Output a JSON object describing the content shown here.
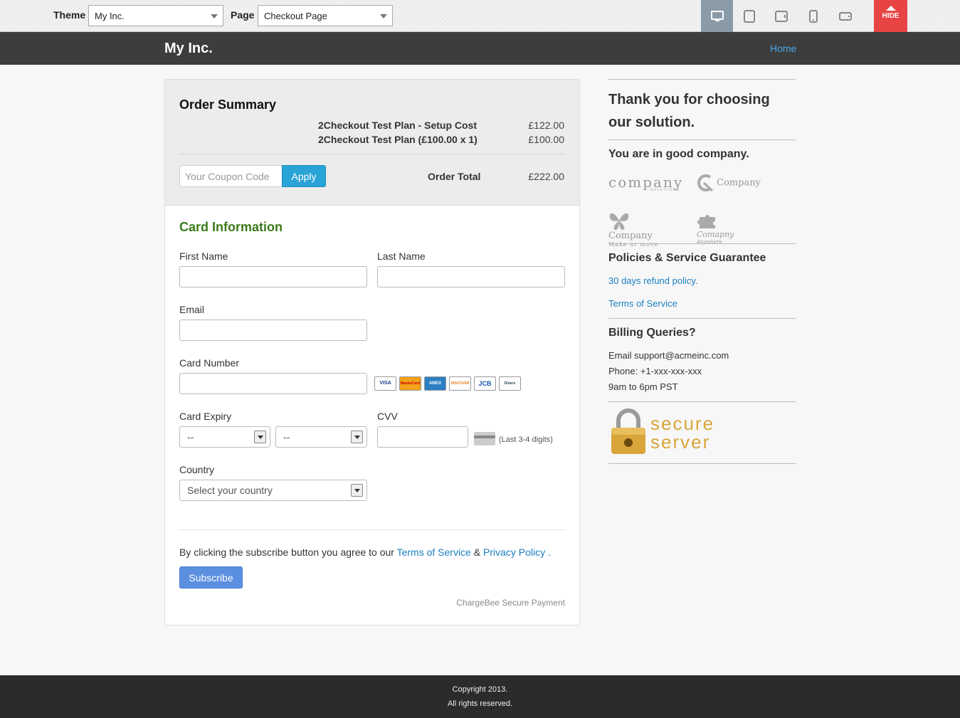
{
  "toolbar": {
    "theme_label": "Theme",
    "theme_value": "My Inc.",
    "page_label": "Page",
    "page_value": "Checkout Page",
    "hide_label": "HIDE",
    "devices": [
      "desktop-icon",
      "tablet-portrait-icon",
      "tablet-landscape-icon",
      "phone-portrait-icon",
      "phone-landscape-icon"
    ]
  },
  "header": {
    "brand": "My Inc.",
    "home": "Home"
  },
  "order_summary": {
    "title": "Order Summary",
    "items": [
      {
        "label": "2Checkout Test Plan - Setup Cost",
        "amount": "£122.00"
      },
      {
        "label": "2Checkout Test Plan (£100.00 x 1)",
        "amount": "£100.00"
      }
    ],
    "coupon_placeholder": "Your Coupon Code",
    "apply_label": "Apply",
    "total_label": "Order Total",
    "total_amount": "£222.00"
  },
  "card_form": {
    "title": "Card Information",
    "first_name_label": "First Name",
    "last_name_label": "Last Name",
    "email_label": "Email",
    "card_number_label": "Card Number",
    "card_expiry_label": "Card Expiry",
    "expiry_month_value": "--",
    "expiry_year_value": "--",
    "cvv_label": "CVV",
    "cvv_hint": "(Last 3-4 digits)",
    "country_label": "Country",
    "country_value": "Select your country",
    "card_brands": [
      "VISA",
      "MasterCard",
      "AMEX",
      "DISCOVER",
      "JCB",
      "Diners"
    ],
    "agree_prefix": "By clicking the subscribe button you agree to our",
    "terms_link": "Terms of Service",
    "amp": "&",
    "privacy_link": "Privacy Policy",
    "agree_suffix": ".",
    "subscribe_label": "Subscribe",
    "secure_note": "ChargeBee Secure Payment"
  },
  "sidebar": {
    "thanks_heading": "Thank you for choosing our solution.",
    "good_company": "You are in good company.",
    "logos": [
      {
        "name": "company",
        "sub": "SOLUTIONS"
      },
      {
        "name": "Company",
        "sub": ""
      },
      {
        "name": "Company",
        "sub": "Make ur move"
      },
      {
        "name": "Comapny",
        "sub": "Anywhere"
      }
    ],
    "policies_heading": "Policies & Service Guarantee",
    "refund_link": "30 days refund policy.",
    "terms_link": "Terms of Service",
    "billing_heading": "Billing Queries?",
    "email": "Email support@acmeinc.com",
    "phone": "Phone: +1-xxx-xxx-xxx",
    "hours": "9am to 6pm PST",
    "secure_line1": "secure",
    "secure_line2": "server"
  },
  "footer": {
    "copyright": "Copyright 2013.",
    "rights": "All rights reserved."
  },
  "colors": {
    "header_bg": "#3d3d3d",
    "link": "#1a7fc1",
    "card_title": "#3a7a1a",
    "apply": "#2aa3d6",
    "subscribe": "#5b8fe0",
    "hide_ribbon": "#e84444",
    "secure_gold": "#d9a53a"
  }
}
